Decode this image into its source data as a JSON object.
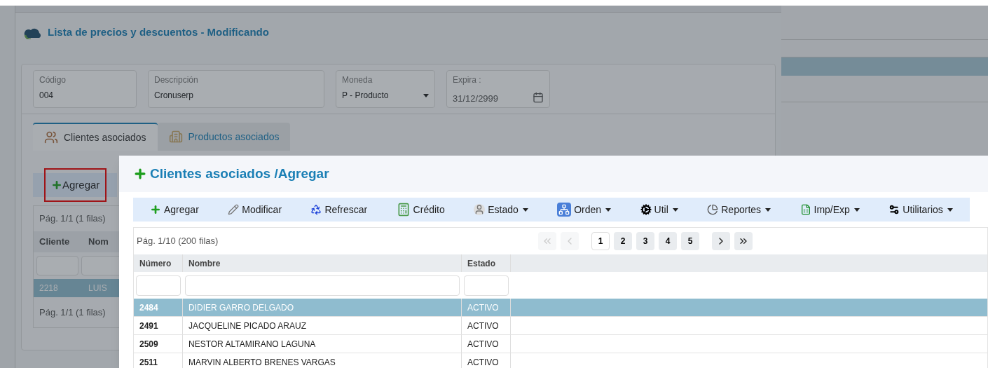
{
  "background": {
    "title": "Lista de precios y descuentos - Modificando",
    "fields": [
      {
        "kind": "text",
        "label": "Código",
        "value": "004"
      },
      {
        "kind": "text",
        "label": "Descripción",
        "value": "Cronuserp"
      },
      {
        "kind": "select",
        "label": "Moneda",
        "value": "P - Producto"
      },
      {
        "kind": "date",
        "label": "Expira :",
        "value": "31/12/2999"
      }
    ],
    "tabs": [
      {
        "label": "Clientes asociados",
        "selected": true
      },
      {
        "label": "Productos asociados",
        "selected": false
      }
    ],
    "add_button": "Agregar",
    "grid": {
      "pager_top": "Pág. 1/1 (1 filas)",
      "columns": [
        "Cliente",
        "Nom"
      ],
      "rows": [
        {
          "cells": [
            "2218",
            "LUIS"
          ],
          "selected": true
        }
      ],
      "pager_bottom": "Pág. 1/1 (1 filas)"
    }
  },
  "modal": {
    "title": "Clientes asociados /Agregar",
    "toolbar": [
      {
        "label": "Agregar",
        "menu": false
      },
      {
        "label": "Modificar",
        "menu": false
      },
      {
        "label": "Refrescar",
        "menu": false
      },
      {
        "label": "Crédito",
        "menu": false
      },
      {
        "label": "Estado",
        "menu": true
      },
      {
        "label": "Orden",
        "menu": true
      },
      {
        "label": "Util",
        "menu": true
      },
      {
        "label": "Reportes",
        "menu": true
      },
      {
        "label": "Imp/Exp",
        "menu": true
      },
      {
        "label": "Utilitarios",
        "menu": true
      }
    ],
    "pager": {
      "info": "Pág. 1/10 (200 filas)",
      "nav_back": [
        {
          "kind": "first",
          "disabled": true
        },
        {
          "kind": "prev",
          "disabled": true
        }
      ],
      "pages": [
        {
          "label": "1",
          "selected": true
        },
        {
          "label": "2",
          "selected": false
        },
        {
          "label": "3",
          "selected": false
        },
        {
          "label": "4",
          "selected": false
        },
        {
          "label": "5",
          "selected": false
        }
      ],
      "nav_forward": [
        {
          "kind": "next",
          "disabled": false
        },
        {
          "kind": "last",
          "disabled": false
        }
      ]
    },
    "columns": [
      "Número",
      "Nombre",
      "Estado"
    ],
    "rows": [
      {
        "cells": [
          "2484",
          "DIDIER GARRO DELGADO",
          "ACTIVO"
        ],
        "selected": true
      },
      {
        "cells": [
          "2491",
          "JACQUELINE PICADO ARAUZ",
          "ACTIVO"
        ],
        "selected": false
      },
      {
        "cells": [
          "2509",
          "NESTOR ALTAMIRANO LAGUNA",
          "ACTIVO"
        ],
        "selected": false
      },
      {
        "cells": [
          "2511",
          "MARVIN ALBERTO BRENES VARGAS",
          "ACTIVO"
        ],
        "selected": false
      }
    ]
  }
}
